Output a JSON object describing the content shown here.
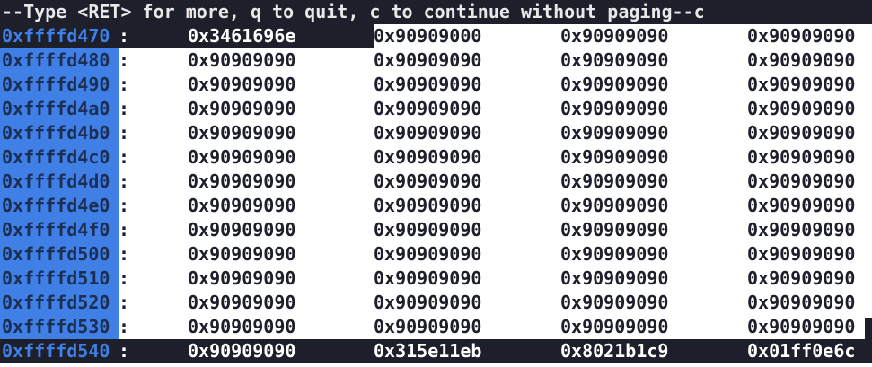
{
  "prompt": "--Type <RET> for more, q to quit, c to continue without paging--c",
  "separator": ":",
  "rows": [
    {
      "addr": "0xffffd470",
      "words": [
        "0x3461696e",
        "0x90909000",
        "0x90909090",
        "0x90909090"
      ]
    },
    {
      "addr": "0xffffd480",
      "words": [
        "0x90909090",
        "0x90909090",
        "0x90909090",
        "0x90909090"
      ]
    },
    {
      "addr": "0xffffd490",
      "words": [
        "0x90909090",
        "0x90909090",
        "0x90909090",
        "0x90909090"
      ]
    },
    {
      "addr": "0xffffd4a0",
      "words": [
        "0x90909090",
        "0x90909090",
        "0x90909090",
        "0x90909090"
      ]
    },
    {
      "addr": "0xffffd4b0",
      "words": [
        "0x90909090",
        "0x90909090",
        "0x90909090",
        "0x90909090"
      ]
    },
    {
      "addr": "0xffffd4c0",
      "words": [
        "0x90909090",
        "0x90909090",
        "0x90909090",
        "0x90909090"
      ]
    },
    {
      "addr": "0xffffd4d0",
      "words": [
        "0x90909090",
        "0x90909090",
        "0x90909090",
        "0x90909090"
      ]
    },
    {
      "addr": "0xffffd4e0",
      "words": [
        "0x90909090",
        "0x90909090",
        "0x90909090",
        "0x90909090"
      ]
    },
    {
      "addr": "0xffffd4f0",
      "words": [
        "0x90909090",
        "0x90909090",
        "0x90909090",
        "0x90909090"
      ]
    },
    {
      "addr": "0xffffd500",
      "words": [
        "0x90909090",
        "0x90909090",
        "0x90909090",
        "0x90909090"
      ]
    },
    {
      "addr": "0xffffd510",
      "words": [
        "0x90909090",
        "0x90909090",
        "0x90909090",
        "0x90909090"
      ]
    },
    {
      "addr": "0xffffd520",
      "words": [
        "0x90909090",
        "0x90909090",
        "0x90909090",
        "0x90909090"
      ]
    },
    {
      "addr": "0xffffd530",
      "words": [
        "0x90909090",
        "0x90909090",
        "0x90909090",
        "0x90909090"
      ]
    },
    {
      "addr": "0xffffd540",
      "words": [
        "0x90909090",
        "0x315e11eb",
        "0x8021b1c9",
        "0x01ff0e6c"
      ]
    }
  ],
  "colors": {
    "terminal_bg": "#1d1f2a",
    "address_highlight": "#3f7fe6",
    "text_light": "#ffffff",
    "text_dark": "#1d1f2a"
  }
}
